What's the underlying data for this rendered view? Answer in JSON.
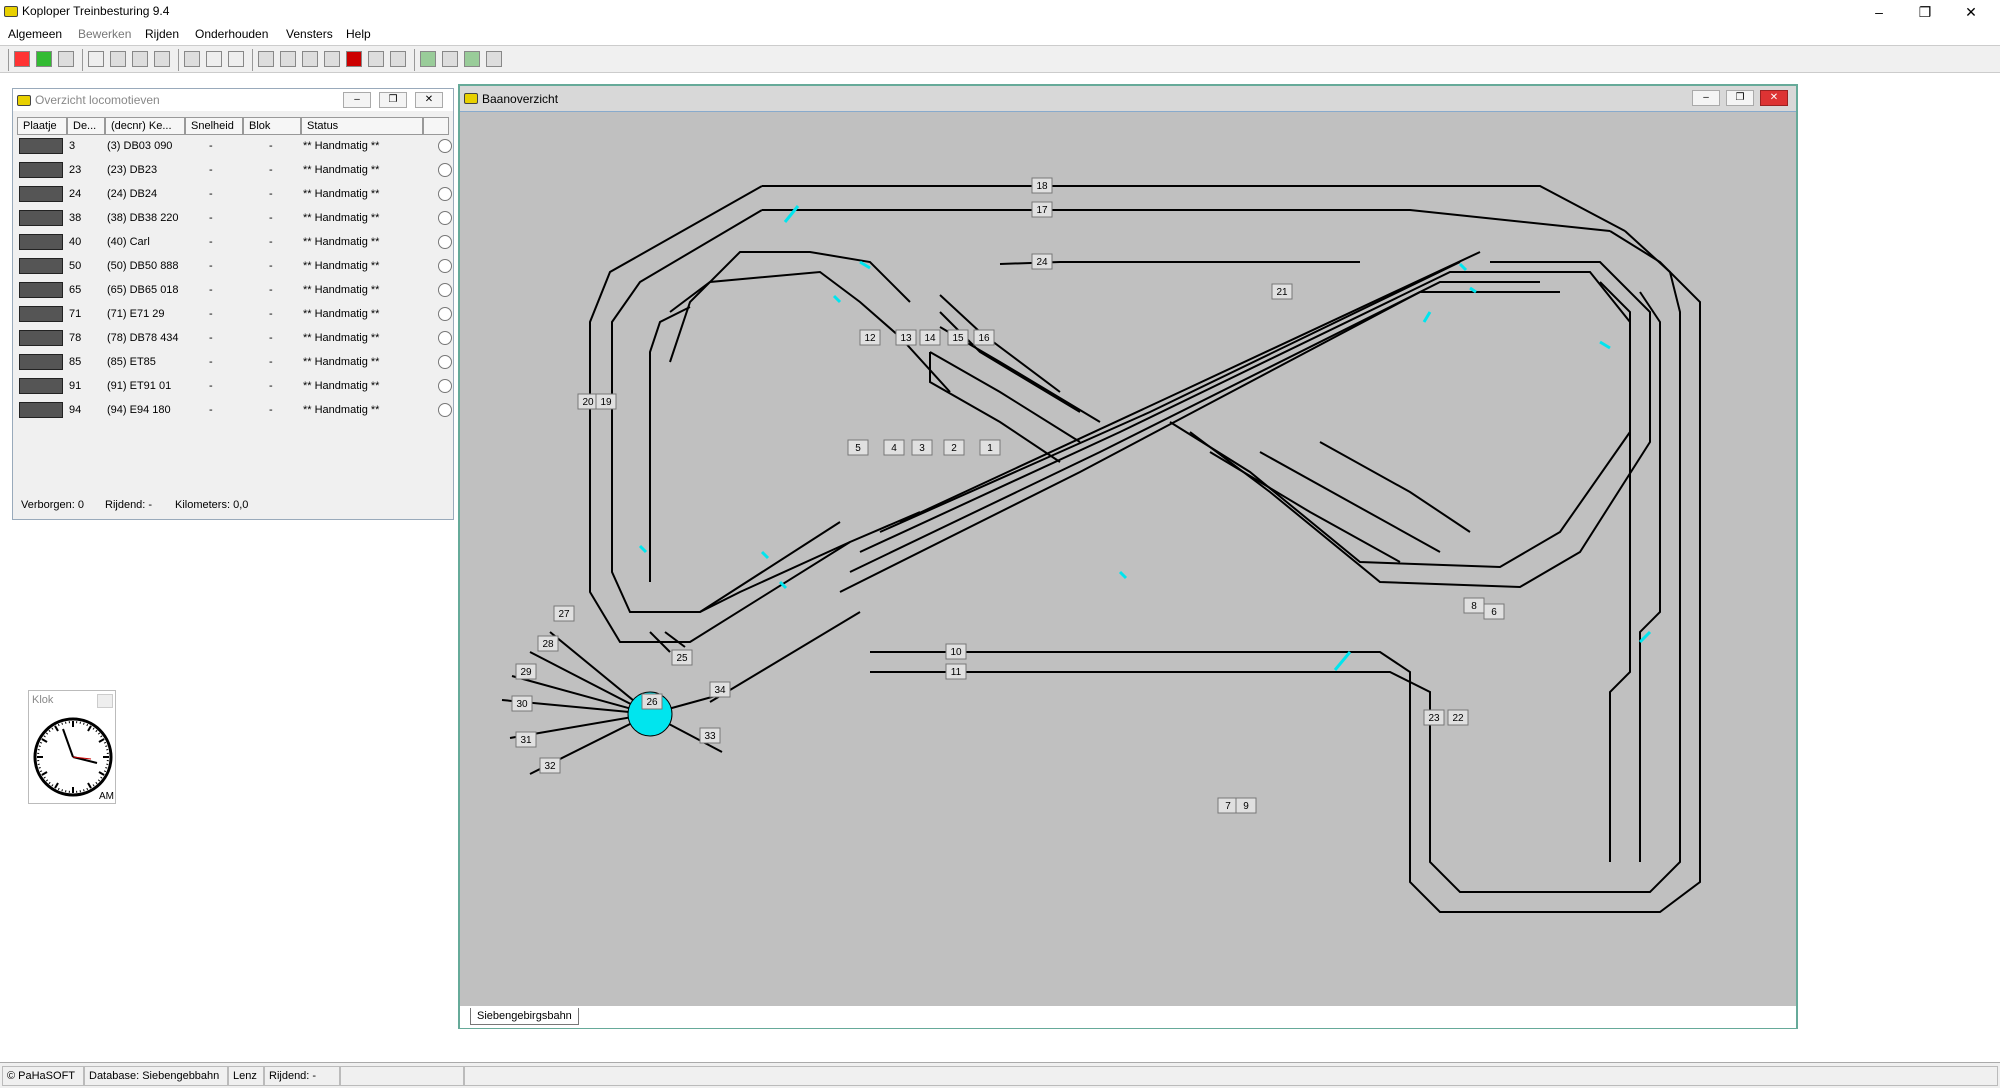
{
  "app": {
    "title": "Koploper Treinbesturing 9.4",
    "window_controls": {
      "minimize": "–",
      "maximize": "❐",
      "close": "✕"
    }
  },
  "menu": [
    "Algemeen",
    "Bewerken",
    "Rijden",
    "Onderhouden",
    "Vensters",
    "Help"
  ],
  "loco_window": {
    "title": "Overzicht locomotieven",
    "columns": [
      "Plaatje",
      "De...",
      "(decnr) Ke...",
      "Snelheid",
      "Blok",
      "Status"
    ],
    "rows": [
      {
        "nr": "3",
        "name": "(3) DB03 090",
        "speed": "-",
        "block": "-",
        "status": "** Handmatig **"
      },
      {
        "nr": "23",
        "name": "(23) DB23",
        "speed": "-",
        "block": "-",
        "status": "** Handmatig **"
      },
      {
        "nr": "24",
        "name": "(24) DB24",
        "speed": "-",
        "block": "-",
        "status": "** Handmatig **"
      },
      {
        "nr": "38",
        "name": "(38) DB38 220",
        "speed": "-",
        "block": "-",
        "status": "** Handmatig **"
      },
      {
        "nr": "40",
        "name": "(40) Carl",
        "speed": "-",
        "block": "-",
        "status": "** Handmatig **"
      },
      {
        "nr": "50",
        "name": "(50) DB50 888",
        "speed": "-",
        "block": "-",
        "status": "** Handmatig **"
      },
      {
        "nr": "65",
        "name": "(65) DB65 018",
        "speed": "-",
        "block": "-",
        "status": "** Handmatig **"
      },
      {
        "nr": "71",
        "name": "(71) E71 29",
        "speed": "-",
        "block": "-",
        "status": "** Handmatig **"
      },
      {
        "nr": "78",
        "name": "(78) DB78 434",
        "speed": "-",
        "block": "-",
        "status": "** Handmatig **"
      },
      {
        "nr": "85",
        "name": "(85) ET85",
        "speed": "-",
        "block": "-",
        "status": "** Handmatig **"
      },
      {
        "nr": "91",
        "name": "(91) ET91 01",
        "speed": "-",
        "block": "-",
        "status": "** Handmatig **"
      },
      {
        "nr": "94",
        "name": "(94) E94 180",
        "speed": "-",
        "block": "-",
        "status": "** Handmatig **"
      }
    ],
    "footer": {
      "hidden": "Verborgen: 0",
      "driving": "Rijdend: -",
      "km": "Kilometers: 0,0"
    }
  },
  "clock": {
    "title": "Klok",
    "ampm": "AM"
  },
  "layout_window": {
    "title": "Baanoverzicht",
    "tab": "Siebengebirgsbahn",
    "blocks": [
      "18",
      "17",
      "24",
      "21",
      "12",
      "13",
      "14",
      "15",
      "16",
      "20",
      "19",
      "5",
      "4",
      "3",
      "2",
      "1",
      "10",
      "11",
      "27",
      "28",
      "29",
      "30",
      "31",
      "32",
      "26",
      "25",
      "34",
      "33",
      "8",
      "6",
      "23",
      "22",
      "7",
      "9"
    ]
  },
  "statusbar": [
    "© PaHaSOFT",
    "Database: Siebengebbahn",
    "Lenz",
    "Rijdend: -"
  ],
  "colors": {
    "accent": "#00e5ee",
    "track": "#000000",
    "layout_bg": "#c0c0c0"
  }
}
